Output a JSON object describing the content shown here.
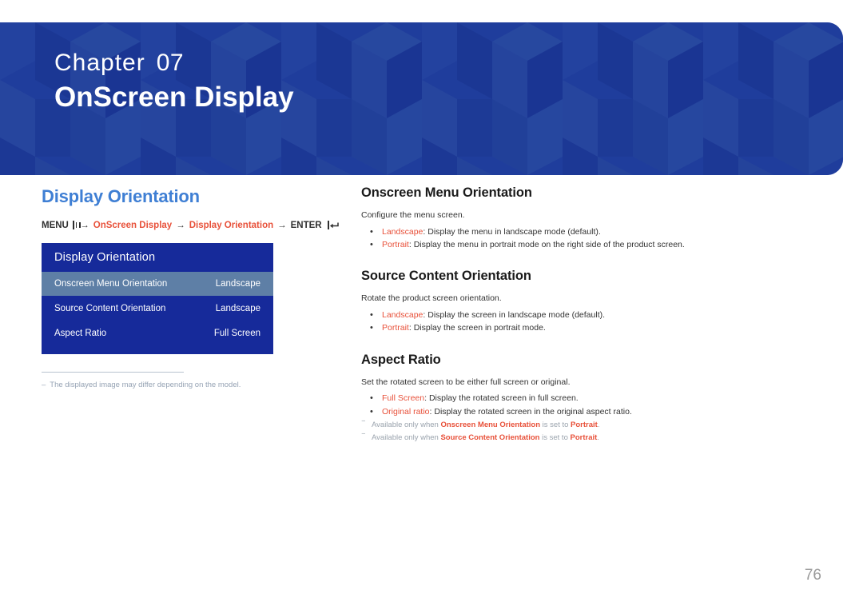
{
  "page": {
    "number": "76",
    "accent_red": "#e8513a",
    "accent_blue": "#3f7fd4",
    "banner_blue": "#1f3d9c",
    "osd_panel_blue": "#162a9a",
    "osd_selected_blue": "#5e7fa6"
  },
  "banner": {
    "chapter_word": "Chapter",
    "chapter_number": "07",
    "chapter_title": "OnScreen Display"
  },
  "left": {
    "section_title": "Display Orientation",
    "breadcrumb": {
      "menu_label": "MENU",
      "menu_icon": "menu-grid-icon",
      "arrow": "→",
      "crumb1": "OnScreen Display",
      "crumb2": "Display Orientation",
      "enter_label": "ENTER",
      "enter_icon": "enter-key-icon"
    },
    "osd": {
      "header": "Display Orientation",
      "rows": [
        {
          "label": "Onscreen Menu Orientation",
          "value": "Landscape",
          "selected": true
        },
        {
          "label": "Source Content Orientation",
          "value": "Landscape",
          "selected": false
        },
        {
          "label": "Aspect Ratio",
          "value": "Full Screen",
          "selected": false
        }
      ]
    },
    "note": {
      "dash": "–",
      "text": "The displayed image may differ depending on the model."
    }
  },
  "right": {
    "sections": [
      {
        "title": "Onscreen Menu Orientation",
        "intro": "Configure the menu screen.",
        "bullets": [
          {
            "term": "Landscape",
            "sep": ": ",
            "text": "Display the menu in landscape mode (default)."
          },
          {
            "term": "Portrait",
            "sep": ": ",
            "text": "Display the menu in portrait mode on the right side of the product screen."
          }
        ],
        "footnotes": []
      },
      {
        "title": "Source Content Orientation",
        "intro": "Rotate the product screen orientation.",
        "bullets": [
          {
            "term": "Landscape",
            "sep": ": ",
            "text": "Display the screen in landscape mode (default)."
          },
          {
            "term": "Portrait",
            "sep": ": ",
            "text": "Display the screen in portrait mode."
          }
        ],
        "footnotes": []
      },
      {
        "title": "Aspect Ratio",
        "intro": "Set the rotated screen to be either full screen or original.",
        "bullets": [
          {
            "term": "Full Screen",
            "sep": ": ",
            "text": "Display the rotated screen in full screen."
          },
          {
            "term": "Original ratio",
            "sep": ": ",
            "text": "Display the rotated screen in the original aspect ratio."
          }
        ],
        "footnotes": [
          {
            "pre": "Available only when ",
            "term1": "Onscreen Menu Orientation",
            "mid": " is set to ",
            "term2": "Portrait",
            "post": "."
          },
          {
            "pre": "Available only when ",
            "term1": "Source Content Orientation",
            "mid": " is set to ",
            "term2": "Portrait",
            "post": "."
          }
        ]
      }
    ]
  }
}
